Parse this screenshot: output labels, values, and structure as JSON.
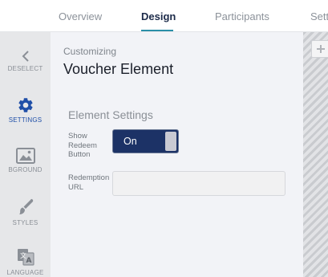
{
  "tabs": [
    {
      "label": "Overview"
    },
    {
      "label": "Design"
    },
    {
      "label": "Participants"
    },
    {
      "label": "Sett"
    }
  ],
  "active_tab": "Design",
  "sidebar": {
    "items": [
      {
        "label": "DESELECT",
        "icon": "chevron-left-icon"
      },
      {
        "label": "SETTINGS",
        "icon": "gear-icon"
      },
      {
        "label": "BGROUND",
        "icon": "image-icon"
      },
      {
        "label": "STYLES",
        "icon": "brush-icon"
      },
      {
        "label": "LANGUAGE",
        "icon": "translate-icon"
      }
    ],
    "active": "SETTINGS"
  },
  "panel": {
    "kicker": "Customizing",
    "title": "Voucher Element",
    "section_title": "Element Settings",
    "show_redeem": {
      "label_lines": [
        "Show",
        "Redeem",
        "Button"
      ],
      "value": "On"
    },
    "redemption_url": {
      "label_lines": [
        "Redemption",
        "URL"
      ],
      "value": ""
    }
  },
  "colors": {
    "accent": "#2a8fa8",
    "toggle_bg": "#1c3266",
    "active_sidebar": "#1f4fa8"
  }
}
